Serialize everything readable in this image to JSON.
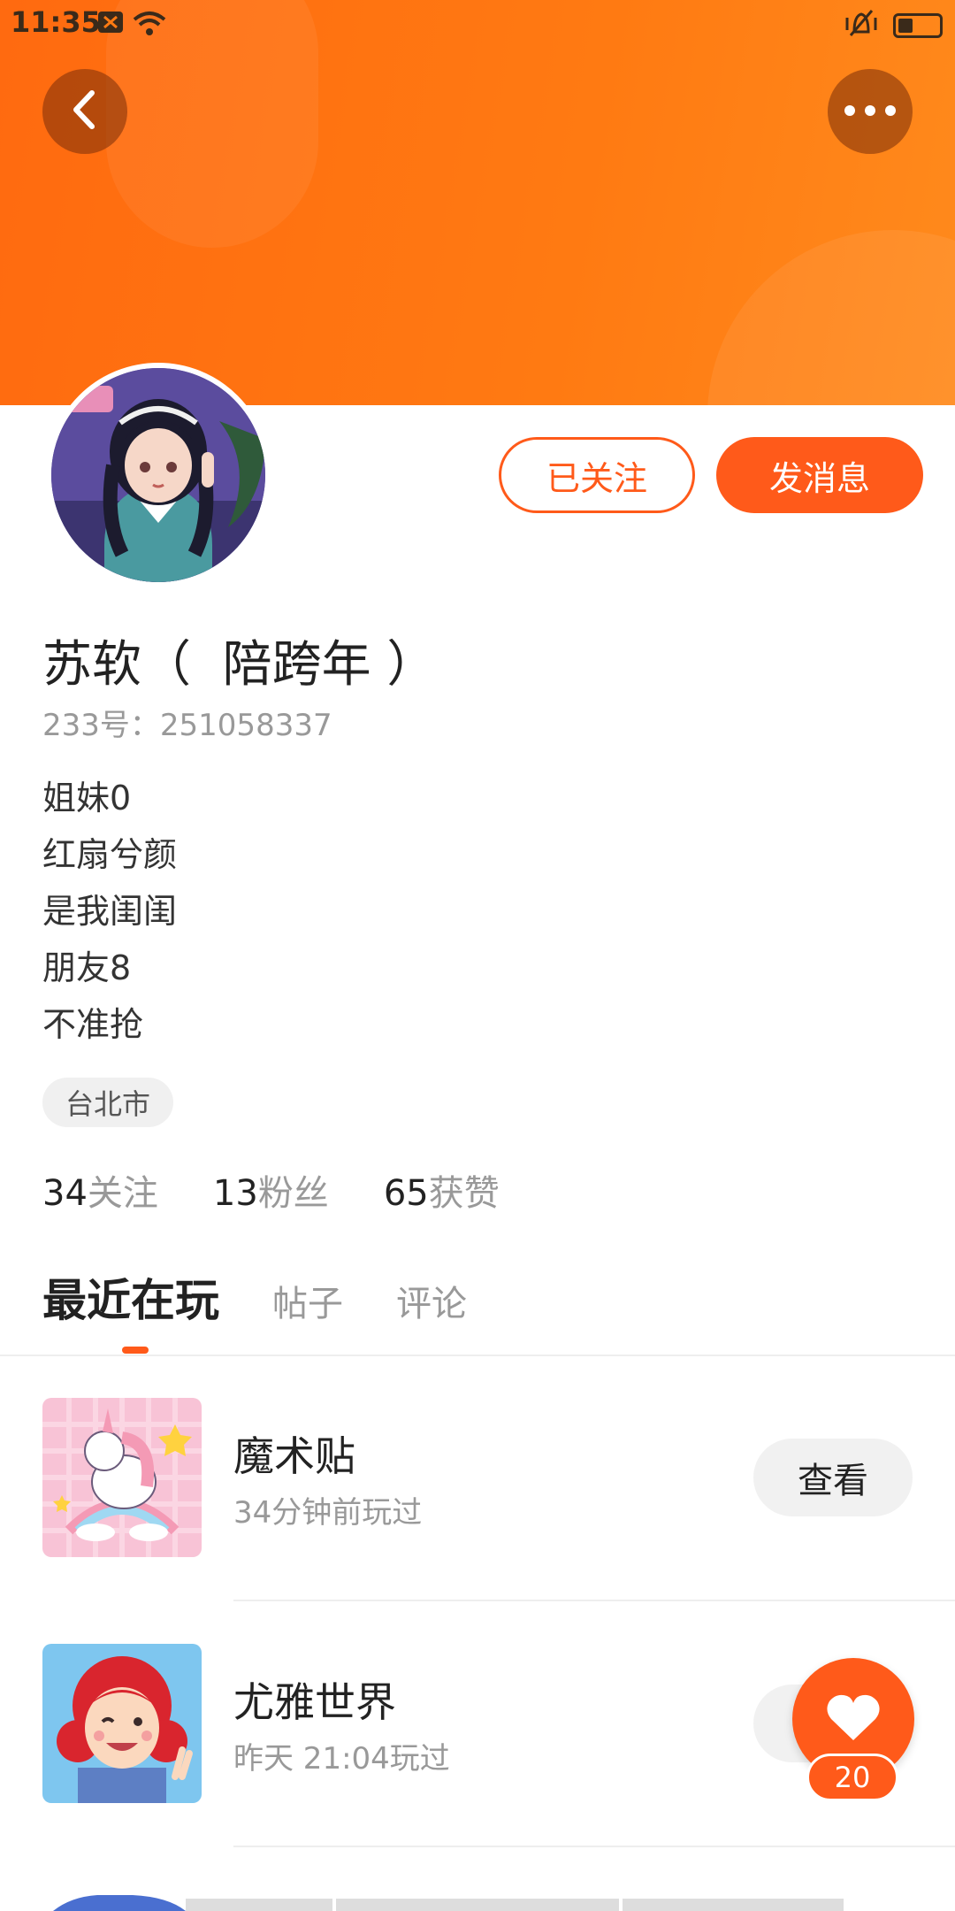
{
  "status_bar": {
    "time": "11:35"
  },
  "profile": {
    "username": "苏软（  陪跨年 ）",
    "id_label": "233号：",
    "id_value": "251058337",
    "bio_lines": [
      "姐妹0",
      "红扇兮颜",
      "是我闺闺",
      "朋友8",
      "不准抢"
    ],
    "location": "台北市",
    "follow_button": "已关注",
    "message_button": "发消息"
  },
  "stats": {
    "following_count": "34",
    "following_label": "关注",
    "fans_count": "13",
    "fans_label": "粉丝",
    "likes_count": "65",
    "likes_label": "获赞"
  },
  "tabs": [
    "最近在玩",
    "帖子",
    "评论"
  ],
  "games": [
    {
      "title": "魔术贴",
      "played": "34分钟前玩过",
      "button": "查看"
    },
    {
      "title": "尤雅世界",
      "played": "昨天  21:04玩过",
      "button": "查看"
    }
  ],
  "like_fab": {
    "count": "20"
  },
  "colors": {
    "accent": "#ff5a1a",
    "banner": "#ff7a12"
  }
}
